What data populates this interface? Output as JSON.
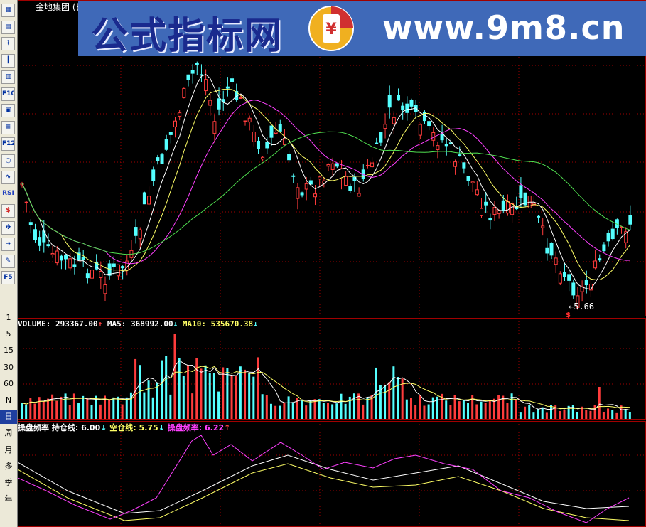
{
  "window": {
    "title": "金地集团 (日"
  },
  "banner": {
    "text_cn": "公式指标网",
    "url": "www.9m8.cn",
    "logo_text": "www.9m8.cn"
  },
  "toolbar": {
    "icons": [
      "grid-icon",
      "table-icon",
      "line-chart-icon",
      "candle-icon",
      "report-icon",
      "f10-icon",
      "doc-icon",
      "f11-icon",
      "f12-icon",
      "zoom-icon",
      "wave-icon",
      "rsi-icon",
      "money-icon",
      "move-icon",
      "export-icon",
      "pencil-icon",
      "f5-icon"
    ],
    "icon_labels": {
      "f10": "F10",
      "rsi": "RSI",
      "f12": "F12",
      "f5": "F5"
    },
    "periods": [
      "1",
      "5",
      "15",
      "30",
      "60",
      "N",
      "日",
      "周",
      "月",
      "多",
      "季",
      "年"
    ],
    "selected_period": "日"
  },
  "price_panel": {
    "low_marker": "←5.66"
  },
  "volume_panel": {
    "label": "VOLUME:",
    "value": "293367.00",
    "ma5_label": "MA5:",
    "ma5_value": "368992.00",
    "ma10_label": "MA10:",
    "ma10_value": "535670.38"
  },
  "indicator_panel": {
    "name": "操盘频率",
    "hold_label": "持仓线:",
    "hold_value": "6.00",
    "empty_label": "空仓线:",
    "empty_value": "5.75",
    "freq_label": "操盘频率:",
    "freq_value": "6.22"
  },
  "colors": {
    "up": "#ff3c3c",
    "down": "#54ffff",
    "ma_white": "#ffffff",
    "ma_yellow": "#ffff66",
    "ma_magenta": "#ff40ff",
    "ma_green": "#50e050",
    "grid": "#a00000"
  }
}
